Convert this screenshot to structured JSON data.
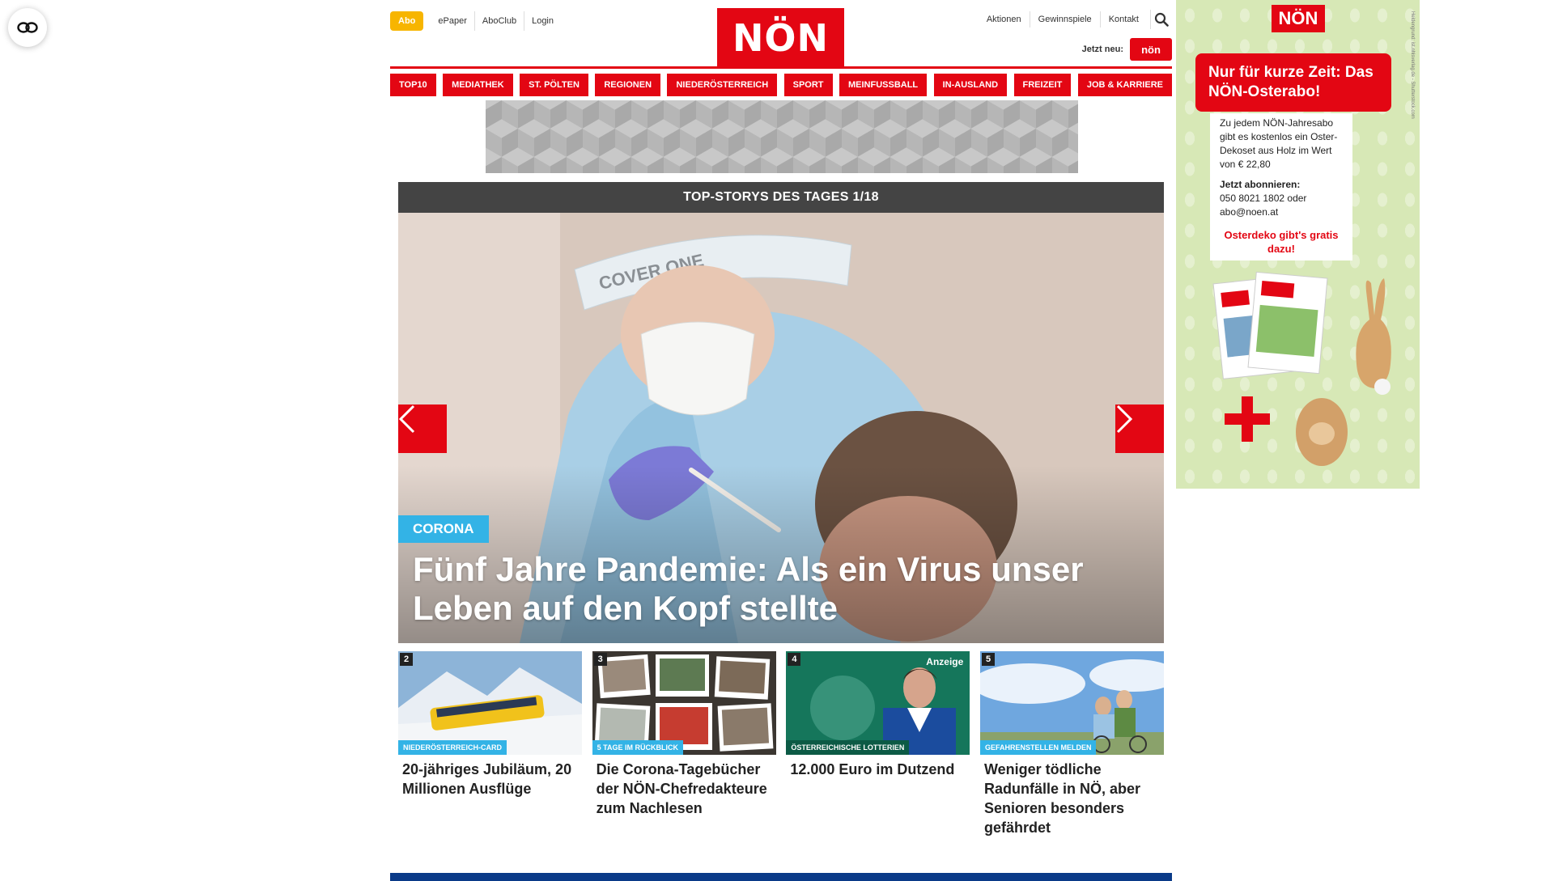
{
  "header": {
    "abo_label": "Abo",
    "links_left": [
      "ePaper",
      "AboClub",
      "Login"
    ],
    "logo_text": "NÖN",
    "links_right": [
      "Aktionen",
      "Gewinnspiele",
      "Kontakt"
    ],
    "jetzt_label": "Jetzt neu:",
    "mini_logo_text": "nön"
  },
  "nav": {
    "items": [
      "TOP10",
      "MEDIATHEK",
      "ST. PÖLTEN",
      "REGIONEN",
      "NIEDERÖSTERREICH",
      "SPORT",
      "MEINFUSSBALL",
      "IN-AUSLAND",
      "FREIZEIT",
      "JOB & KARRIERE"
    ]
  },
  "carousel": {
    "heading": "TOP-STORYS DES TAGES 1/18",
    "tag": "CORONA",
    "title": "Fünf Jahre Pandemie: Als ein Virus unser Leben auf den Kopf stellte",
    "visor_text": "COVER ONE"
  },
  "teasers": [
    {
      "num": "2",
      "tag": "NIEDERÖSTERREICH-CARD",
      "title": "20-jähriges Jubiläum, 20 Millionen Ausflüge",
      "anzeige": ""
    },
    {
      "num": "3",
      "tag": "5 TAGE IM RÜCKBLICK",
      "title": "Die Corona-Tagebücher der NÖN-Chefredakteure zum Nachlesen",
      "anzeige": ""
    },
    {
      "num": "4",
      "tag": "ÖSTERREICHISCHE LOTTERIEN",
      "title": "12.000 Euro im Dutzend",
      "anzeige": "Anzeige"
    },
    {
      "num": "5",
      "tag": "GEFAHRENSTELLEN MELDEN",
      "title": "Weniger tödliche Radunfälle in NÖ, aber Senioren besonders gefährdet",
      "anzeige": ""
    }
  ],
  "side_ad": {
    "logo_text": "NÖN",
    "headline": "Nur für kurze Zeit: Das NÖN-Osterabo!",
    "body_text": "Zu jedem NÖN-Jahresabo gibt es kostenlos ein Oster-Dekoset aus Holz im Wert von € 22,80",
    "cta_label": "Jetzt abonnieren:",
    "contact": "050 8021 1802 oder abo@noen.at",
    "promo": "Osterdeko gibt's gratis dazu!",
    "vertical_note": "Heldengrund: ist.nhlsverlag.de - Shutterstock.com"
  },
  "colors": {
    "brand_red": "#e30613",
    "accent_blue": "#33b3e6",
    "abo_yellow": "#f7b500",
    "footer_blue": "#0a3a88"
  }
}
